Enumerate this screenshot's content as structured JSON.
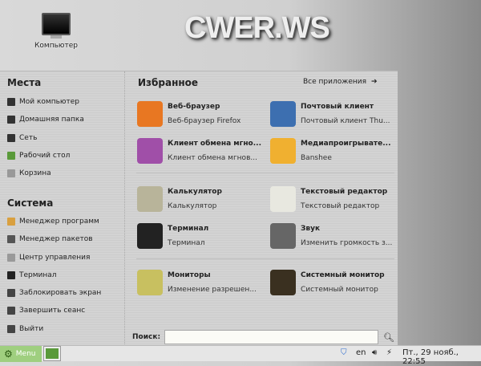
{
  "desktop": {
    "icon_label": "Компьютер",
    "wallpaper_logo": "CWER.WS"
  },
  "menu": {
    "places": {
      "title": "Места",
      "items": [
        {
          "label": "Мой компьютер",
          "icon": "computer-icon",
          "color": "#333"
        },
        {
          "label": "Домашняя папка",
          "icon": "home-icon",
          "color": "#333"
        },
        {
          "label": "Сеть",
          "icon": "network-icon",
          "color": "#333"
        },
        {
          "label": "Рабочий стол",
          "icon": "desktop-icon",
          "color": "#5a9a3a"
        },
        {
          "label": "Корзина",
          "icon": "trash-icon",
          "color": "#999"
        }
      ]
    },
    "system": {
      "title": "Система",
      "items": [
        {
          "label": "Менеджер программ",
          "icon": "software-manager-icon",
          "color": "#d9a040"
        },
        {
          "label": "Менеджер пакетов",
          "icon": "package-manager-icon",
          "color": "#555"
        },
        {
          "label": "Центр управления",
          "icon": "control-center-icon",
          "color": "#999"
        },
        {
          "label": "Терминал",
          "icon": "terminal-icon",
          "color": "#222"
        },
        {
          "label": "Заблокировать экран",
          "icon": "lock-icon",
          "color": "#444"
        },
        {
          "label": "Завершить сеанс",
          "icon": "logout-icon",
          "color": "#444"
        },
        {
          "label": "Выйти",
          "icon": "power-icon",
          "color": "#444"
        }
      ]
    },
    "favorites": {
      "title": "Избранное",
      "all_apps": "Все приложения",
      "items": [
        {
          "title": "Веб-браузер",
          "subtitle": "Веб-браузер Firefox",
          "icon": "firefox-icon",
          "color": "#e87722"
        },
        {
          "title": "Почтовый клиент",
          "subtitle": "Почтовый клиент Thu...",
          "icon": "thunderbird-icon",
          "color": "#3d6fb0"
        },
        {
          "title": "Клиент обмена мгно...",
          "subtitle": "Клиент обмена мгнов...",
          "icon": "pidgin-icon",
          "color": "#a04fa8"
        },
        {
          "title": "Медиапроигрывате...",
          "subtitle": "Banshee",
          "icon": "banshee-icon",
          "color": "#f0b030"
        },
        {
          "title": "Калькулятор",
          "subtitle": "Калькулятор",
          "icon": "calculator-icon",
          "color": "#b8b49a"
        },
        {
          "title": "Текстовый редактор",
          "subtitle": "Текстовый редактор",
          "icon": "text-editor-icon",
          "color": "#e8e8e0"
        },
        {
          "title": "Терминал",
          "subtitle": "Терминал",
          "icon": "terminal-icon",
          "color": "#222"
        },
        {
          "title": "Звук",
          "subtitle": "Изменить громкость з...",
          "icon": "sound-icon",
          "color": "#666"
        },
        {
          "title": "Мониторы",
          "subtitle": "Изменение разрешен...",
          "icon": "monitors-icon",
          "color": "#c8c060"
        },
        {
          "title": "Системный монитор",
          "subtitle": "Системный монитор",
          "icon": "system-monitor-icon",
          "color": "#3a3020"
        }
      ]
    },
    "search": {
      "label": "Поиск:",
      "value": ""
    }
  },
  "taskbar": {
    "menu_label": "Menu",
    "lang": "en",
    "clock": "Пт., 29 нояб., 22:55"
  }
}
